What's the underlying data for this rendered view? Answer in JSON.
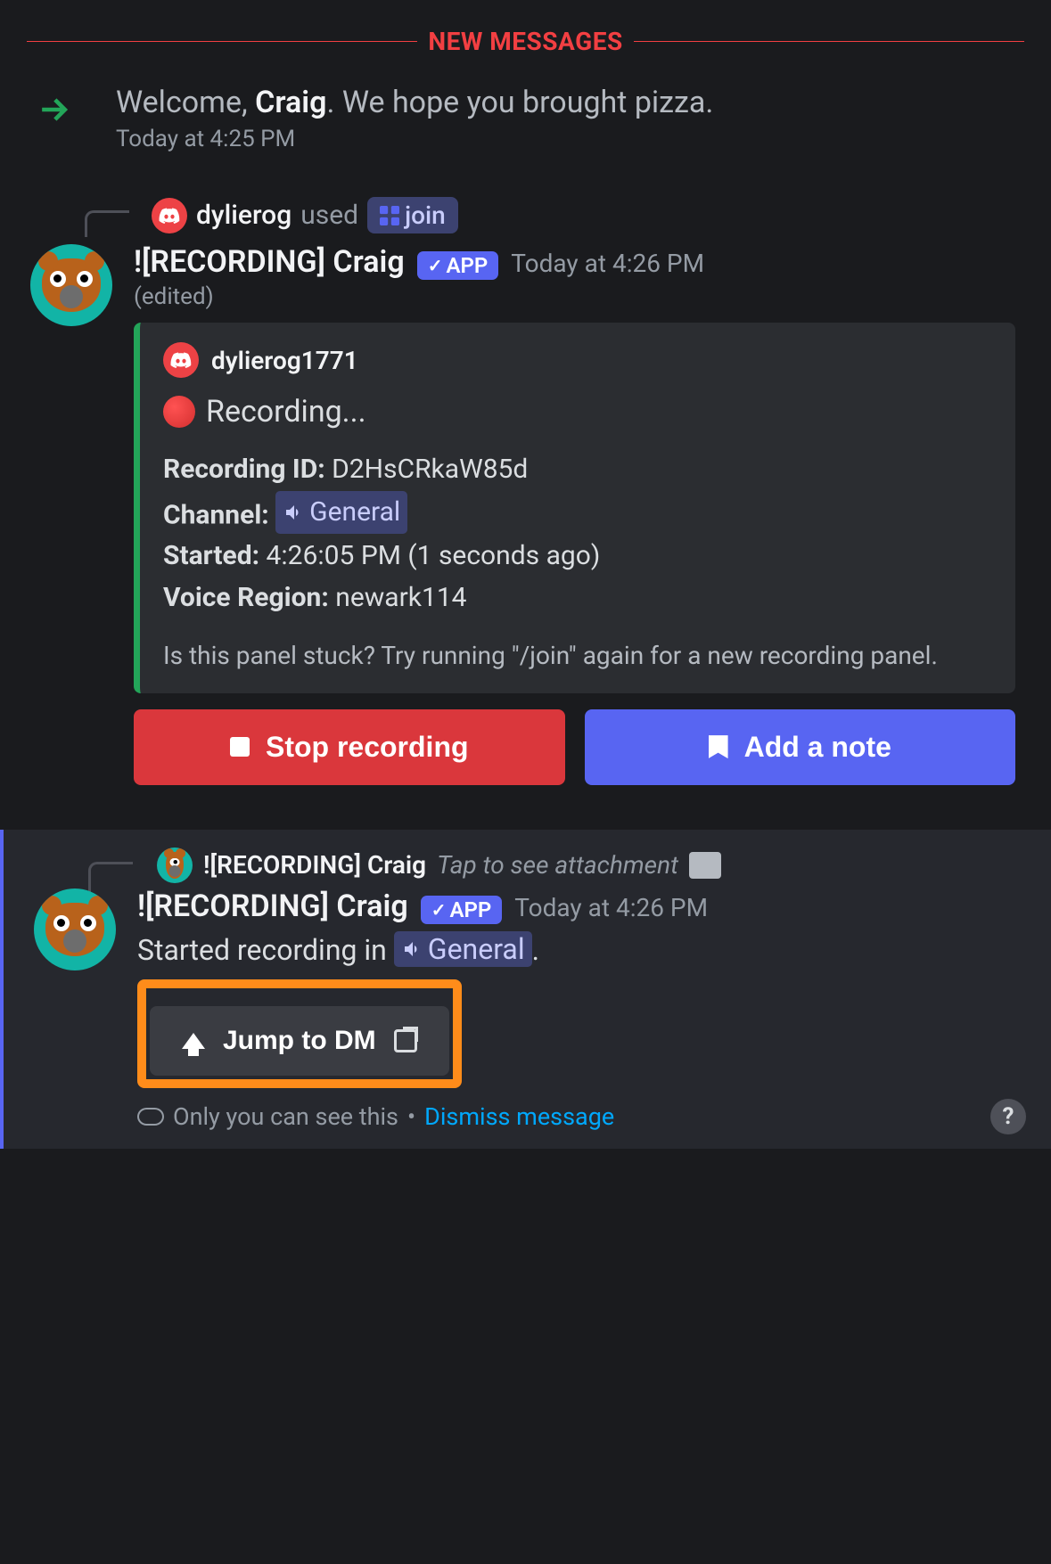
{
  "divider": {
    "label": "NEW MESSAGES"
  },
  "welcome": {
    "prefix": "Welcome, ",
    "name": "Craig",
    "suffix": ". We hope you brought pizza.",
    "timestamp": "Today at 4:25 PM"
  },
  "command": {
    "user": "dylierog",
    "action": "used",
    "name": "join"
  },
  "botMessage": {
    "author": "![RECORDING] Craig",
    "app_badge": "APP",
    "timestamp": "Today at 4:26 PM",
    "edited": "(edited)"
  },
  "embed": {
    "author": "dylierog1771",
    "title": "Recording...",
    "recording_id_label": "Recording ID:",
    "recording_id": "D2HsCRkaW85d",
    "channel_label": "Channel:",
    "channel": "General",
    "started_label": "Started:",
    "started_value": "4:26:05 PM (1 seconds ago)",
    "region_label": "Voice Region:",
    "region": "newark114",
    "footer": "Is this panel stuck? Try running \"/join\" again for a new recording panel."
  },
  "buttons": {
    "stop": "Stop recording",
    "note": "Add a note"
  },
  "ephemeral": {
    "reply_author": "![RECORDING] Craig",
    "reply_hint": "Tap to see attachment",
    "author": "![RECORDING] Craig",
    "app_badge": "APP",
    "timestamp": "Today at 4:26 PM",
    "started_prefix": "Started recording in ",
    "channel": "General",
    "started_suffix": ".",
    "jump_label": "Jump to DM",
    "only_you": "Only you can see this",
    "separator": "•",
    "dismiss": "Dismiss message"
  }
}
